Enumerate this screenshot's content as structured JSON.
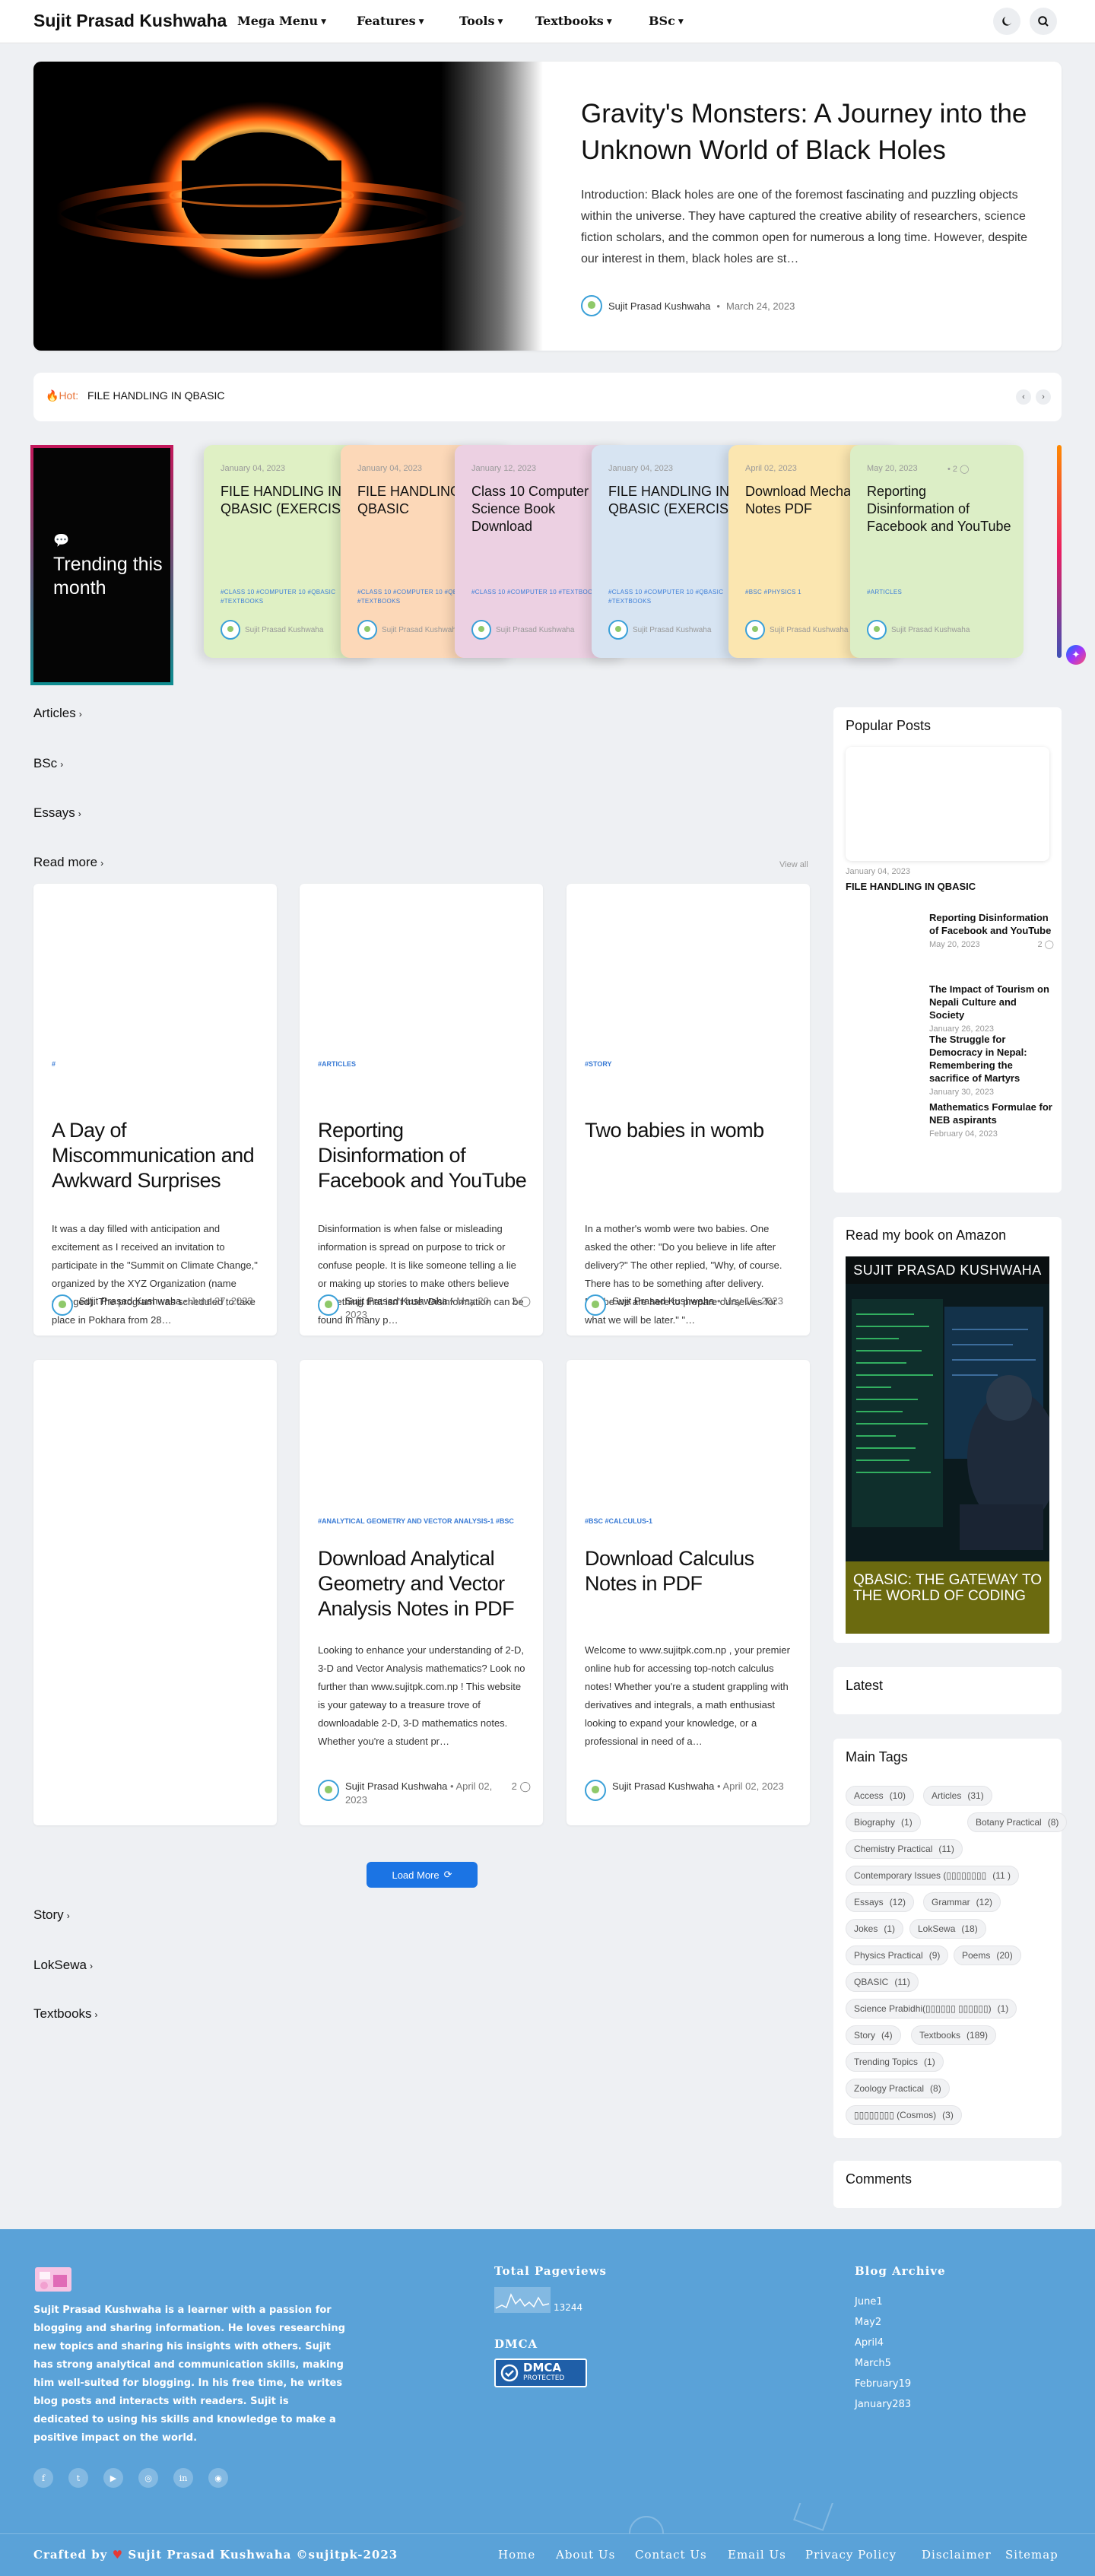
{
  "header": {
    "site_title": "Sujit Prasad Kushwaha",
    "nav": [
      "Mega Menu",
      "Features",
      "Tools",
      "Textbooks",
      "BSc"
    ]
  },
  "hero": {
    "title": "Gravity's Monsters: A Journey into the Unknown World of Black Holes",
    "excerpt": "Introduction: Black holes are one of the foremost fascinating and puzzling objects within the universe. They have captured the creative ability of researchers, science fiction scholars, and the common open for numerous a long time. However, despite our interest in them, black holes are st…",
    "author": "Sujit Prasad Kushwaha",
    "date": "March 24, 2023"
  },
  "hot": {
    "label": "Hot",
    "text": "FILE HANDLING IN QBASIC"
  },
  "trending": {
    "title": "Trending this month",
    "cards": [
      {
        "date": "January 04, 2023",
        "title": "FILE HANDLING IN QBASIC (EXERCISE)",
        "tags": "#CLASS 10   #COMPUTER 10   #QBASIC   #TEXTBOOKS",
        "author": "Sujit Prasad Kushwaha",
        "color": "#dff0c4"
      },
      {
        "date": "January 04, 2023",
        "title": "FILE HANDLING IN QBASIC",
        "tags": "#CLASS 10   #COMPUTER 10   #QBASIC   #TEXTBOOKS",
        "author": "Sujit Prasad Kushwaha",
        "color": "#fcd8b8"
      },
      {
        "date": "January 12, 2023",
        "title": "Class 10 Computer Science Book Download",
        "tags": "#CLASS 10   #COMPUTER 10   #TEXTBOOKS",
        "author": "Sujit Prasad Kushwaha",
        "color": "#ecd0e2"
      },
      {
        "date": "January 04, 2023",
        "title": "FILE HANDLING IN QBASIC (EXERCISE)",
        "tags": "#CLASS 10   #COMPUTER 10   #QBASIC   #TEXTBOOKS",
        "author": "Sujit Prasad Kushwaha",
        "color": "#d7e4f2"
      },
      {
        "date": "April 02, 2023",
        "title": "Download Mechanics Notes PDF",
        "tags": "#BSC   #PHYSICS 1",
        "author": "Sujit Prasad Kushwaha",
        "color": "#fbe6b0"
      },
      {
        "date": "May 20, 2023",
        "comments": "2",
        "title": "Reporting Disinformation of Facebook and YouTube",
        "tags": "#ARTICLES",
        "author": "Sujit Prasad Kushwaha",
        "color": "#dceec6"
      }
    ]
  },
  "sections": {
    "articles": "Articles",
    "bsc": "BSc",
    "essays": "Essays",
    "read_more": "Read more",
    "view_all": "View all",
    "story": "Story",
    "loksewa": "LokSewa",
    "textbooks": "Textbooks"
  },
  "posts": [
    {
      "label": "#",
      "title": "A Day of Miscommunication and Awkward Surprises",
      "excerpt": "It was a day filled with anticipation and excitement as I received an invitation to participate in the \"Summit on Climate Change,\" organized by the XYZ Organization (name changed). The program was scheduled to take place in Pokhara from 28…",
      "author": "Sujit Prasad Kushwaha",
      "date": "June 27, 2023"
    },
    {
      "label": "#ARTICLES",
      "title": "Reporting Disinformation of Facebook and YouTube",
      "excerpt": "Disinformation is when false or misleading information is spread on purpose to trick or confuse people. It is like someone telling a lie or making up stories to make others believe something that isn't true. Disinformation can be found in many p…",
      "author": "Sujit Prasad Kushwaha",
      "date": "May 20, 2023",
      "comments": "2"
    },
    {
      "label": "#STORY",
      "title": "Two babies in womb",
      "excerpt": "In a mother's womb were two babies. One asked the other: \"Do you believe in life after delivery?\" The other replied, \"Why, of course. There has to be something after delivery. Maybe we are here to prepare ourselves for what we will be later.\" \"…",
      "author": "Sujit Prasad Kushwaha",
      "date": "May 16, 2023"
    },
    {
      "label": "",
      "title": "",
      "excerpt": "",
      "author": "",
      "date": ""
    },
    {
      "label": "#ANALYTICAL GEOMETRY AND VECTOR ANALYSIS-1   #BSC",
      "title": "Download Analytical Geometry and Vector Analysis Notes in PDF",
      "excerpt": "Looking to enhance your understanding of 2-D, 3-D and Vector Analysis mathematics? Look no further than www.sujitpk.com.np ! This website is your gateway to a treasure trove of downloadable 2-D, 3-D mathematics notes. Whether you're a student pr…",
      "author": "Sujit Prasad Kushwaha",
      "date": "April 02, 2023",
      "comments": "2"
    },
    {
      "label": "#BSC   #CALCULUS-1",
      "title": "Download Calculus Notes in PDF",
      "excerpt": "Welcome to www.sujitpk.com.np , your premier online hub for accessing top-notch calculus notes! Whether you're a student grappling with derivatives and integrals, a math enthusiast looking to expand your knowledge, or a professional in need of a…",
      "author": "Sujit Prasad Kushwaha",
      "date": "April 02, 2023"
    }
  ],
  "load_more": "Load More",
  "sidebar": {
    "popular_title": "Popular Posts",
    "popular_top": {
      "date": "January 04, 2023",
      "title": "FILE HANDLING IN QBASIC"
    },
    "popular": [
      {
        "title": "Reporting Disinformation of Facebook and YouTube",
        "date": "May 20, 2023",
        "comments": "2"
      },
      {
        "title": "The Impact of Tourism on Nepali Culture and Society",
        "date": "January 26, 2023"
      },
      {
        "title": "The Struggle for Democracy in Nepal: Remembering the sacrifice of Martyrs",
        "date": "January 30, 2023"
      },
      {
        "title": "Mathematics Formulae for NEB aspirants",
        "date": "February 04, 2023"
      }
    ],
    "book_title": "Read my book on Amazon",
    "book_author": "SUJIT PRASAD KUSHWAHA",
    "book_cover_title": "QBASIC: THE GATEWAY TO THE WORLD OF CODING",
    "latest_title": "Latest",
    "tags_title": "Main Tags",
    "tags": [
      {
        "name": "Access",
        "count": "(10)"
      },
      {
        "name": "Articles",
        "count": "(31)"
      },
      {
        "name": "Biography",
        "count": "(1)"
      },
      {
        "name": "Botany Practical",
        "count": "(8)"
      },
      {
        "name": "Chemistry Practical",
        "count": "(11)"
      },
      {
        "name": "Contemporary Issues (▯▯▯▯▯▯▯▯",
        "count": "(11 )"
      },
      {
        "name": "Essays",
        "count": "(12)"
      },
      {
        "name": "Grammar",
        "count": "(12)"
      },
      {
        "name": "Jokes",
        "count": "(1)"
      },
      {
        "name": "LokSewa",
        "count": "(18)"
      },
      {
        "name": "Physics Practical",
        "count": "(9)"
      },
      {
        "name": "Poems",
        "count": "(20)"
      },
      {
        "name": "QBASIC",
        "count": "(11)"
      },
      {
        "name": "Science Prabidhi(▯▯▯▯▯▯ ▯▯▯▯▯▯)",
        "count": "(1)"
      },
      {
        "name": "Story",
        "count": "(4)"
      },
      {
        "name": "Textbooks",
        "count": "(189)"
      },
      {
        "name": "Trending Topics",
        "count": "(1)"
      },
      {
        "name": "Zoology Practical",
        "count": "(8)"
      },
      {
        "name": "▯▯▯▯▯▯▯▯ (Cosmos)",
        "count": "(3)"
      }
    ],
    "comments_title": "Comments"
  },
  "footer": {
    "about": "Sujit Prasad Kushwaha is a learner with a passion for blogging and sharing information. He loves researching new topics and sharing his insights with others. Sujit has strong analytical and communication skills, making him well-suited for blogging. In his free time, he writes blog posts and interacts with readers. Sujit is dedicated to using his skills and knowledge to make a positive impact on the world.",
    "pageviews_title": "Total Pageviews",
    "pageviews": "13244",
    "dmca_title": "DMCA",
    "dmca_badge": "DMCA",
    "dmca_badge_sub": "PROTECTED",
    "archive_title": "Blog Archive",
    "archive": [
      {
        "month": "June",
        "count": "1"
      },
      {
        "month": "May",
        "count": "2"
      },
      {
        "month": "April",
        "count": "4"
      },
      {
        "month": "March",
        "count": "5"
      },
      {
        "month": "February",
        "count": "19"
      },
      {
        "month": "January",
        "count": "283"
      }
    ],
    "credit_prefix": "Crafted by",
    "credit_suffix": "Sujit Prasad Kushwaha ©sujitpk-2023",
    "links": [
      "Home",
      "About Us",
      "Contact Us",
      "Email Us",
      "Privacy Policy",
      "Disclaimer",
      "Sitemap"
    ]
  },
  "colors": {
    "accent": "#1b74e4",
    "footer": "#5aa2d8",
    "hot": "#e8753a"
  }
}
